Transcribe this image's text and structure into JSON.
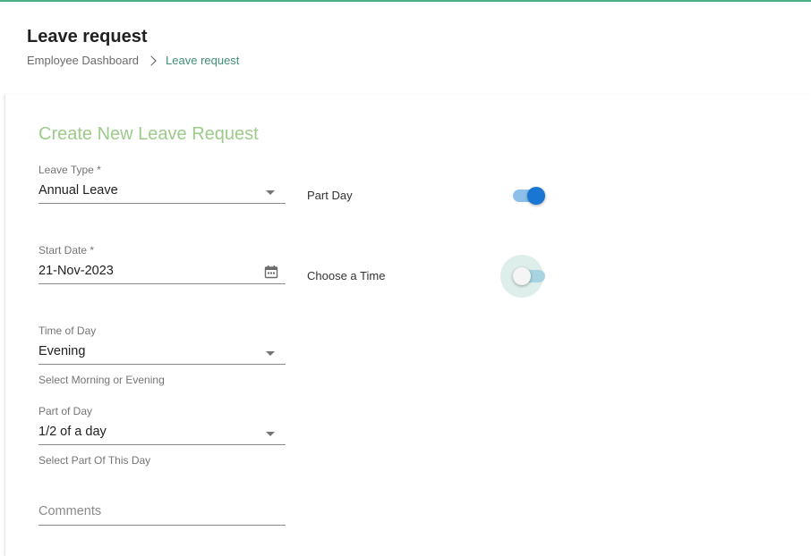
{
  "header": {
    "title": "Leave request",
    "breadcrumb": {
      "parent": "Employee Dashboard",
      "current": "Leave request"
    }
  },
  "form": {
    "title": "Create New Leave Request",
    "leave_type": {
      "label": "Leave Type *",
      "value": "Annual Leave"
    },
    "start_date": {
      "label": "Start Date *",
      "value": "21-Nov-2023"
    },
    "time_of_day": {
      "label": "Time of Day",
      "value": "Evening",
      "hint": "Select Morning or Evening"
    },
    "part_of_day": {
      "label": "Part of Day",
      "value": "1/2 of a day",
      "hint": "Select Part Of This Day"
    },
    "comments": {
      "placeholder": "Comments"
    },
    "part_day_toggle": {
      "label": "Part Day",
      "on": true
    },
    "choose_time_toggle": {
      "label": "Choose a Time",
      "on": false
    }
  },
  "icons": {
    "dropdown": "caret-down-icon",
    "calendar": "calendar-icon",
    "breadcrumb_sep": "chevron-right-icon"
  },
  "colors": {
    "accent_top": "#4caf85",
    "form_title": "#9ccb8a",
    "breadcrumb_current": "#3f8f79",
    "toggle_on_knob": "#1976d2",
    "toggle_on_track": "#8cc0ea"
  }
}
